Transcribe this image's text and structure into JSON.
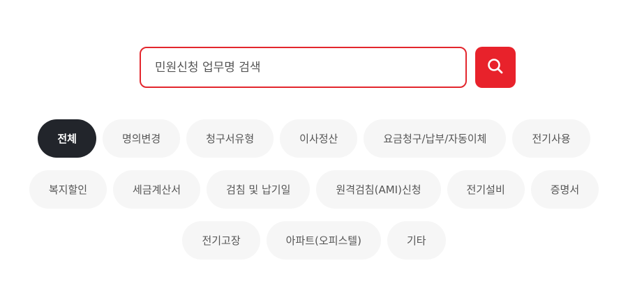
{
  "search": {
    "placeholder": "민원신청 업무명 검색",
    "button_icon": "search-icon",
    "accent_color": "#e8222b"
  },
  "categories": [
    [
      "전체",
      "명의변경",
      "청구서유형",
      "이사정산",
      "요금청구/납부/자동이체",
      "전기사용"
    ],
    [
      "복지할인",
      "세금계산서",
      "검침 및 납기일",
      "원격검침(AMI)신청",
      "전기설비",
      "증명서"
    ],
    [
      "전기고장",
      "아파트(오피스텔)",
      "기타"
    ]
  ],
  "active_category": "전체"
}
